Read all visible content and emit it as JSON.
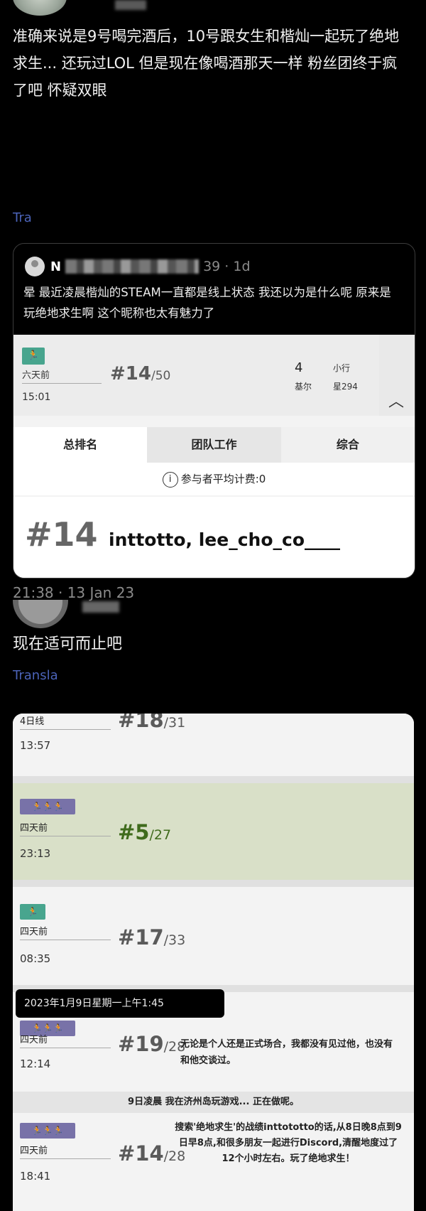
{
  "post1": {
    "text": "准确来说是9号喝完酒后，10号跟女生和楷灿一起玩了绝地求生... 还玩过LOL 但是现在像喝酒那天一样 粉丝团终于疯了吧 怀疑双眼",
    "translate": "Tra"
  },
  "quote": {
    "name_initial": "N",
    "meta": "39 · 1d",
    "text": "晕 最近凌晨楷灿的STEAM一直都是线上状态 我还以为是什么呢 原来是玩绝地求生啊 这个昵称也太有魅力了",
    "game": {
      "date": "六天前",
      "time": "15:01",
      "rank": "#14",
      "total": "/50",
      "kills": "4",
      "kills_label": "基尔",
      "rank_label": "小行",
      "rank_value": "星294",
      "tabs": [
        "总排名",
        "团队工作",
        "综合"
      ],
      "avg_label": "参与者平均计费:0",
      "team_rank": "#14",
      "team_names": "inttotto, lee_cho_co____"
    }
  },
  "timestamp": "21:38 · 13 Jan 23",
  "post2": {
    "text": "现在适可而止吧",
    "translate": "Transla"
  },
  "matches": [
    {
      "date": "4日线",
      "time": "13:57",
      "rank": "#18",
      "total": "/31"
    },
    {
      "date": "四天前",
      "time": "23:13",
      "rank": "#5",
      "total": "/27"
    },
    {
      "date": "四天前",
      "time": "08:35",
      "rank": "#17",
      "total": "/33"
    },
    {
      "date": "四天前",
      "time": "12:14",
      "rank": "#19",
      "total": "/28"
    },
    {
      "date": "四天前",
      "time": "18:41",
      "rank": "#14",
      "total": "/28"
    }
  ],
  "tooltip": "2023年1月9日星期一上午1:45",
  "captions": {
    "c1": "无论是个人还是正式场合，我都没有见过他，也没有和他交谈过。",
    "c2": "9日凌晨 我在济州岛玩游戏... 正在做呢。",
    "c3": "搜索'绝地求生'的战绩inttototto的话,从8日晚8点到9日早8点,和很多朋友一起进行Discord,清醒地度过了12个小时左右。玩了绝地求生！"
  },
  "colors": {
    "translate": "#4b63b8",
    "teal_badge": "#48a58e",
    "purple_badge": "#7872a8",
    "win_row": "#d9e0c8"
  }
}
